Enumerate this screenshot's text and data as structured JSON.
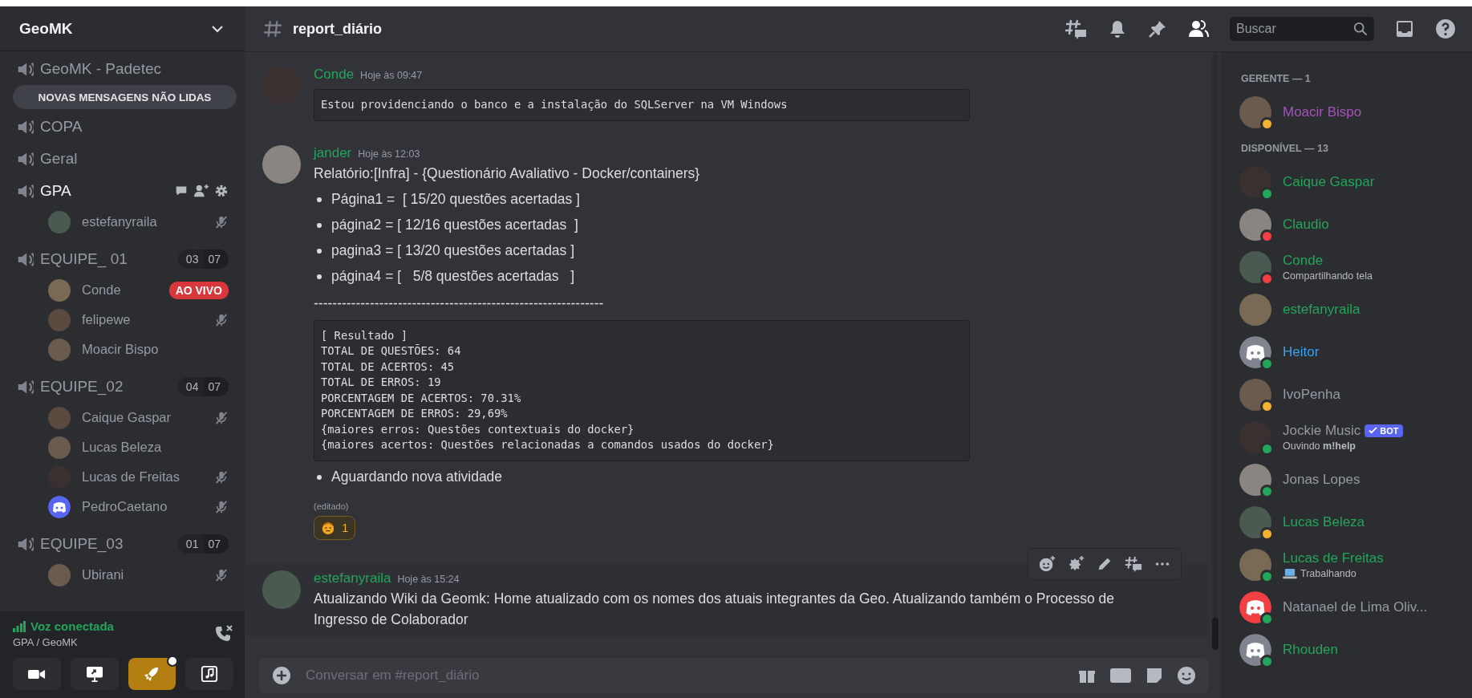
{
  "server": {
    "name": "GeoMK"
  },
  "unread_banner": "NOVAS MENSAGENS NÃO LIDAS",
  "channels": [
    {
      "name": "GeoMK - Padetec",
      "selected": false
    },
    {
      "name": "COPA",
      "selected": false
    },
    {
      "name": "Geral",
      "selected": false
    },
    {
      "name": "GPA",
      "selected": true,
      "children": [
        {
          "name": "estefanyraila",
          "muted": true
        }
      ]
    },
    {
      "name": "EQUIPE_ 01",
      "selected": false,
      "count": "03",
      "limit": "07",
      "children": [
        {
          "name": "Conde",
          "muted": false,
          "live": "AO VIVO"
        },
        {
          "name": "felipewe",
          "muted": true
        },
        {
          "name": "Moacir Bispo",
          "muted": false
        }
      ]
    },
    {
      "name": "EQUIPE_02",
      "selected": false,
      "count": "04",
      "limit": "07",
      "children": [
        {
          "name": "Caique Gaspar",
          "muted": true
        },
        {
          "name": "Lucas Beleza",
          "muted": false
        },
        {
          "name": "Lucas de Freitas",
          "muted": true
        },
        {
          "name": "PedroCaetano",
          "color": "#5865f2",
          "muted": true
        }
      ]
    },
    {
      "name": "EQUIPE_03",
      "selected": false,
      "count": "01",
      "limit": "07",
      "children": [
        {
          "name": "Ubirani",
          "muted": true
        }
      ]
    }
  ],
  "voice": {
    "status": "Voz conectada",
    "location": "GPA / GeoMK",
    "controls": [
      {
        "kind": "camera",
        "on": false
      },
      {
        "kind": "screen",
        "on": false
      },
      {
        "kind": "activity",
        "on": true
      },
      {
        "kind": "soundboard",
        "on": false
      }
    ]
  },
  "channel_header": {
    "name": "report_diário"
  },
  "search": {
    "placeholder": "Buscar"
  },
  "messages": [
    {
      "author": "Conde",
      "time": "Hoje às 09:47",
      "highlighted": false,
      "blocks": [
        {
          "kind": "code",
          "lines": [
            "Estou providenciando o banco e a instalação do SQLServer na VM Windows"
          ]
        }
      ]
    },
    {
      "author": "jander",
      "time": "Hoje às 12:03",
      "highlighted": false,
      "blocks": [
        {
          "kind": "text",
          "text": "Relatório:[Infra] - {Questionário Avaliativo - Docker/containers}"
        },
        {
          "kind": "bullets",
          "items": [
            "Página1 =  [ 15/20 questões acertadas ]",
            "página2 = [ 12/16 questões acertadas  ]",
            "pagina3 = [ 13/20 questões acertadas ]",
            "página4 = [   5/8 questões acertadas   ]"
          ]
        },
        {
          "kind": "text",
          "text": "--------------------------------------------------------------"
        },
        {
          "kind": "code",
          "lines": [
            "[ Resultado ]",
            "TOTAL DE QUESTÕES: 64",
            "TOTAL DE ACERTOS: 45",
            "TOTAL DE ERROS: 19",
            "PORCENTAGEM DE ACERTOS: 70.31%",
            "PORCENTAGEM DE ERROS: 29,69%",
            "{maiores erros: Questões contextuais do docker}",
            "{maiores acertos: Questões relacionadas a comandos usados do docker}"
          ]
        },
        {
          "kind": "bullets",
          "items": [
            "Aguardando nova atividade"
          ]
        }
      ],
      "edited": "(editado)",
      "reactions": [
        {
          "count": "1",
          "selected": true
        }
      ]
    },
    {
      "author": "estefanyraila",
      "time": "Hoje às 15:24",
      "highlighted": true,
      "blocks": [
        {
          "kind": "text",
          "text": "Atualizando Wiki da Geomk: Home atualizado com os nomes dos atuais integrantes da Geo. Atualizando também o Processo de Ingresso de Colaborador"
        }
      ]
    }
  ],
  "composer": {
    "placeholder": "Conversar em #report_diário"
  },
  "member_groups": [
    {
      "title": "GERENTE — 1",
      "members": [
        {
          "name": "Moacir Bispo",
          "color": "#a652bb",
          "status": {
            "color": "#f0b232"
          }
        }
      ]
    },
    {
      "title": "DISPONÍVEL — 13",
      "members": [
        {
          "name": "Caique Gaspar",
          "color": "#23a55a",
          "status": {
            "color": "#23a55a"
          }
        },
        {
          "name": "Claudio",
          "color": "#23a55a",
          "status": {
            "color": "#f23f43"
          }
        },
        {
          "name": "Conde",
          "color": "#23a55a",
          "status": {
            "color": "#f23f43"
          },
          "activity": "Compartilhando tela"
        },
        {
          "name": "estefanyraila",
          "color": "#23a55a"
        },
        {
          "name": "Heitor",
          "color": "#3ba0f0",
          "status": {
            "color": "#23a55a"
          },
          "default_avatar": {
            "color": "#80848e"
          }
        },
        {
          "name": "IvoPenha",
          "color": "#949ba4",
          "status": {
            "color": "#f0b232"
          }
        },
        {
          "name": "Jockie Music",
          "color": "#949ba4",
          "status": {
            "color": "#23a55a"
          },
          "bot": "BOT",
          "activity": "Ouvindo **m!help**"
        },
        {
          "name": "Jonas Lopes",
          "color": "#949ba4",
          "status": {
            "color": "#23a55a"
          }
        },
        {
          "name": "Lucas Beleza",
          "color": "#23a55a",
          "status": {
            "color": "#f0b232"
          }
        },
        {
          "name": "Lucas de Freitas",
          "color": "#23a55a",
          "status": {
            "color": "#23a55a"
          },
          "activity": "Trabalhando",
          "laptop_icon": true
        },
        {
          "name": "Natanael de Lima Oliv...",
          "color": "#949ba4",
          "status": {
            "color": "#23a55a"
          },
          "default_avatar": {
            "color": "#f23f43"
          }
        },
        {
          "name": "Rhouden",
          "color": "#23a55a",
          "status": {
            "color": "#23a55a"
          },
          "default_avatar": {
            "color": "#80848e"
          }
        }
      ]
    }
  ]
}
